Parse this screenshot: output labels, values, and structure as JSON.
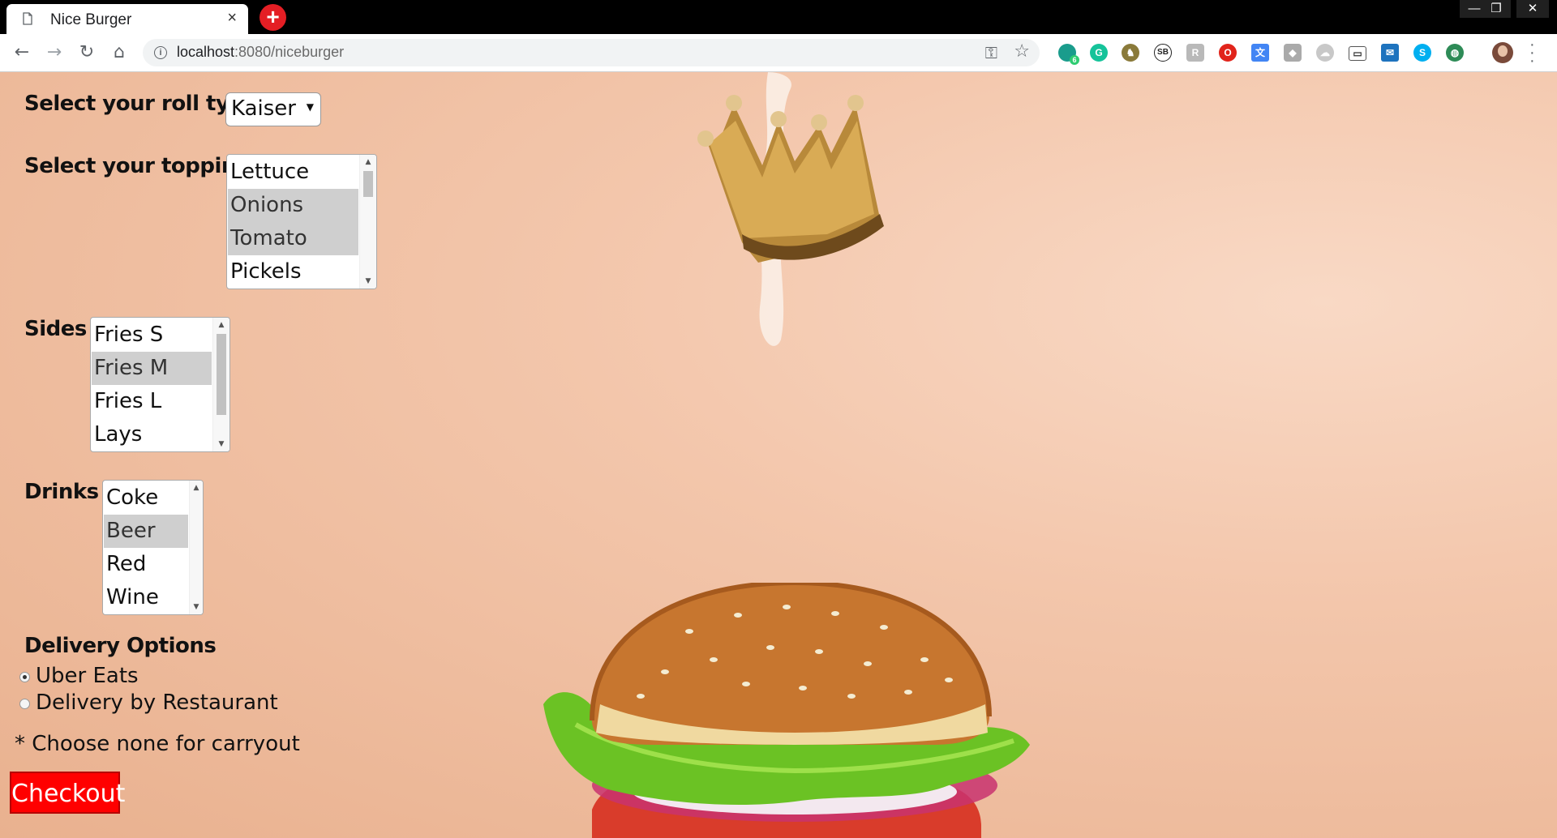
{
  "browser": {
    "tab_title": "Nice Burger",
    "tab_close": "×",
    "new_tab": "+",
    "window_min": "—",
    "window_restore": "❐",
    "window_close": "✕",
    "nav": {
      "back": "←",
      "forward": "→",
      "reload": "↻",
      "home": "⌂"
    },
    "url_host": "localhost",
    "url_rest": ":8080/niceburger",
    "extension_badge": "6"
  },
  "form": {
    "roll_label": "Select your roll type",
    "roll_value": "Kaiser",
    "toppings_label": "Select your toppings",
    "toppings": [
      {
        "label": "Lettuce",
        "selected": false
      },
      {
        "label": "Onions",
        "selected": true
      },
      {
        "label": "Tomato",
        "selected": true
      },
      {
        "label": "Pickels",
        "selected": false
      }
    ],
    "sides_label": "Sides",
    "sides": [
      {
        "label": "Fries S",
        "selected": false
      },
      {
        "label": "Fries M",
        "selected": true
      },
      {
        "label": "Fries L",
        "selected": false
      },
      {
        "label": "Lays",
        "selected": false
      }
    ],
    "drinks_label": "Drinks",
    "drinks": [
      {
        "label": "Coke",
        "selected": false
      },
      {
        "label": "Beer",
        "selected": true
      },
      {
        "label": "Red Wine",
        "selected": false
      }
    ],
    "delivery_label": "Delivery Options",
    "delivery_options": [
      {
        "label": "Uber Eats",
        "checked": true
      },
      {
        "label": "Delivery by Restaurant",
        "checked": false
      }
    ],
    "note": "* Choose none for carryout",
    "checkout_label": "Checkout"
  },
  "colors": {
    "accent": "#ff0000",
    "page_background": "#f3c6ab",
    "selected_option": "#cfcfcf"
  }
}
